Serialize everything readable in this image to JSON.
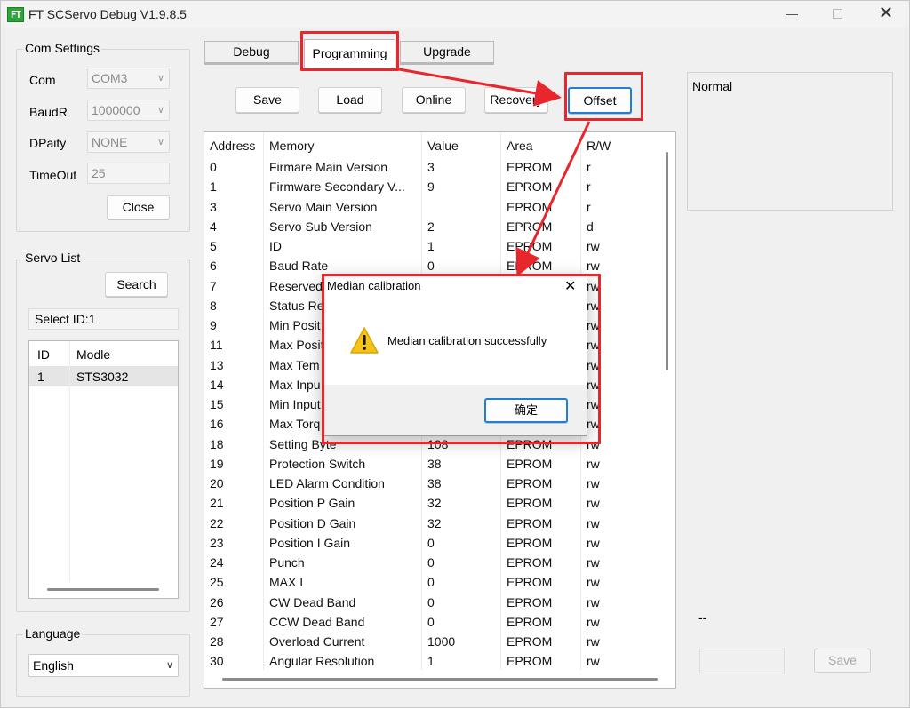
{
  "window": {
    "logo_text": "FT",
    "title": "FT SCServo Debug V1.9.8.5",
    "close_glyph": "✕"
  },
  "com_settings": {
    "title": "Com Settings",
    "com_label": "Com",
    "com_value": "COM3",
    "baud_label": "BaudR",
    "baud_value": "1000000",
    "dparity_label": "DPaity",
    "dparity_value": "NONE",
    "timeout_label": "TimeOut",
    "timeout_value": "25",
    "close_button": "Close"
  },
  "servo_list": {
    "title": "Servo List",
    "search_button": "Search",
    "selected_text": "Select ID:1",
    "columns": [
      "ID",
      "Modle"
    ],
    "rows": [
      [
        "1",
        "STS3032"
      ]
    ]
  },
  "language": {
    "title": "Language",
    "value": "English"
  },
  "tabs": [
    "Debug",
    "Programming",
    "Upgrade"
  ],
  "actions": [
    "Save",
    "Load",
    "Online",
    "Recovery",
    "Offset"
  ],
  "table": {
    "columns": [
      "Address",
      "Memory",
      "Value",
      "Area",
      "R/W"
    ],
    "rows": [
      [
        "0",
        "Firmare Main Version",
        "3",
        "EPROM",
        "r"
      ],
      [
        "1",
        "Firmware Secondary V...",
        "9",
        "EPROM",
        "r"
      ],
      [
        "3",
        "Servo Main Version",
        "",
        "EPROM",
        "r"
      ],
      [
        "4",
        "Servo Sub Version",
        "2",
        "EPROM",
        "d"
      ],
      [
        "5",
        "ID",
        "1",
        "EPROM",
        "rw"
      ],
      [
        "6",
        "Baud Rate",
        "0",
        "EPROM",
        "rw"
      ],
      [
        "7",
        "Reserved",
        "",
        "",
        "rw"
      ],
      [
        "8",
        "Status Re",
        "",
        "",
        "rw"
      ],
      [
        "9",
        "Min Posit",
        "",
        "",
        "rw"
      ],
      [
        "11",
        "Max Posit",
        "",
        "",
        "rw"
      ],
      [
        "13",
        "Max Tem",
        "",
        "",
        "rw"
      ],
      [
        "14",
        "Max Inpu",
        "",
        "",
        "rw"
      ],
      [
        "15",
        "Min Input",
        "",
        "",
        "rw"
      ],
      [
        "16",
        "Max Torq",
        "",
        "",
        "rw"
      ],
      [
        "18",
        "Setting Byte",
        "108",
        "EPROM",
        "rw"
      ],
      [
        "19",
        "Protection Switch",
        "38",
        "EPROM",
        "rw"
      ],
      [
        "20",
        "LED Alarm Condition",
        "38",
        "EPROM",
        "rw"
      ],
      [
        "21",
        "Position P Gain",
        "32",
        "EPROM",
        "rw"
      ],
      [
        "22",
        "Position D Gain",
        "32",
        "EPROM",
        "rw"
      ],
      [
        "23",
        "Position I Gain",
        "0",
        "EPROM",
        "rw"
      ],
      [
        "24",
        "Punch",
        "0",
        "EPROM",
        "rw"
      ],
      [
        "25",
        "MAX I",
        "0",
        "EPROM",
        "rw"
      ],
      [
        "26",
        "CW Dead Band",
        "0",
        "EPROM",
        "rw"
      ],
      [
        "27",
        "CCW Dead Band",
        "0",
        "EPROM",
        "rw"
      ],
      [
        "28",
        "Overload Current",
        "1000",
        "EPROM",
        "rw"
      ],
      [
        "30",
        "Angular Resolution",
        "1",
        "EPROM",
        "rw"
      ]
    ]
  },
  "right_panel": {
    "status_text": "Normal",
    "dash_text": "--",
    "save_button": "Save"
  },
  "dialog": {
    "title": "Median calibration",
    "message": "Median calibration successfully",
    "ok_button": "确定",
    "close_glyph": "✕"
  },
  "colors": {
    "highlight_red": "#e8262b",
    "focus_blue": "#1f7fd6",
    "logo_green": "#2ea43a"
  }
}
